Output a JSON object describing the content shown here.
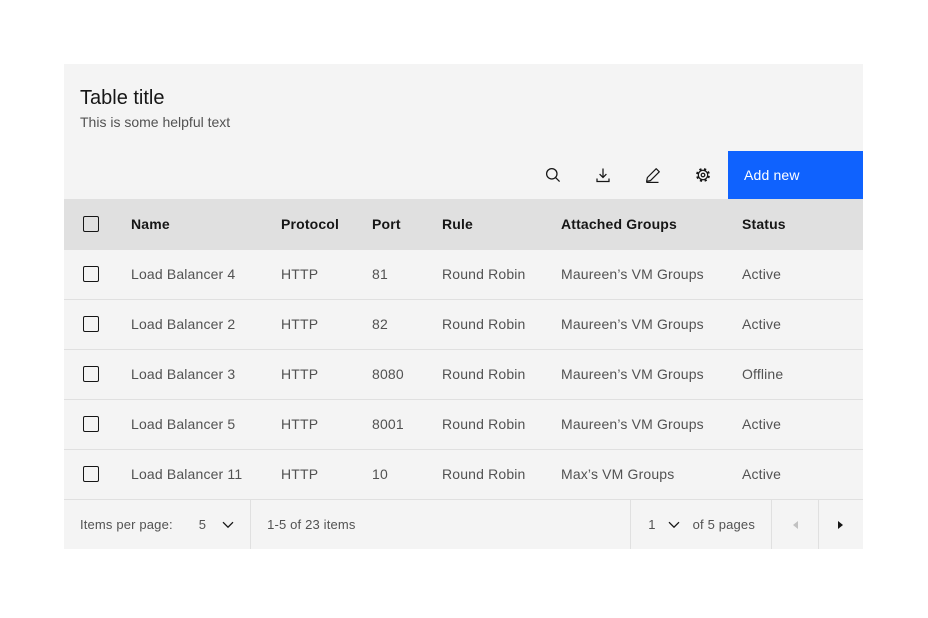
{
  "card": {
    "title": "Table title",
    "description": "This is some helpful text"
  },
  "toolbar": {
    "add_new_label": "Add new",
    "icons": [
      "search-icon",
      "download-icon",
      "edit-icon",
      "settings-icon"
    ]
  },
  "table": {
    "columns": [
      "Name",
      "Protocol",
      "Port",
      "Rule",
      "Attached Groups",
      "Status"
    ],
    "rows": [
      {
        "name": "Load Balancer 4",
        "protocol": "HTTP",
        "port": "81",
        "rule": "Round Robin",
        "attached_groups": "Maureen’s VM Groups",
        "status": "Active"
      },
      {
        "name": "Load Balancer 2",
        "protocol": "HTTP",
        "port": "82",
        "rule": "Round Robin",
        "attached_groups": "Maureen’s VM Groups",
        "status": "Active"
      },
      {
        "name": "Load Balancer 3",
        "protocol": "HTTP",
        "port": "8080",
        "rule": "Round Robin",
        "attached_groups": "Maureen’s VM Groups",
        "status": "Offline"
      },
      {
        "name": "Load Balancer 5",
        "protocol": "HTTP",
        "port": "8001",
        "rule": "Round Robin",
        "attached_groups": "Maureen’s VM Groups",
        "status": "Active"
      },
      {
        "name": "Load Balancer 11",
        "protocol": "HTTP",
        "port": "10",
        "rule": "Round Robin",
        "attached_groups": "Max’s VM Groups",
        "status": "Active"
      }
    ]
  },
  "pagination": {
    "items_per_page_label": "Items per page:",
    "page_size": "5",
    "range_text": "1-5 of 23 items",
    "current_page": "1",
    "pages_label": "of 5 pages",
    "icons": {
      "page_size": "chevron-down-icon",
      "page_number": "chevron-down-icon",
      "previous": "caret-left-icon",
      "next": "caret-right-icon"
    }
  },
  "colors": {
    "accent_blue": "#0f62fe",
    "card_background": "#f4f4f4",
    "header_row_background": "#e0e0e0",
    "row_border": "#e0e0e0",
    "text_primary": "#161616",
    "text_secondary": "#525252",
    "button_text": "#ffffff",
    "disabled_icon": "#c1c1c1"
  }
}
